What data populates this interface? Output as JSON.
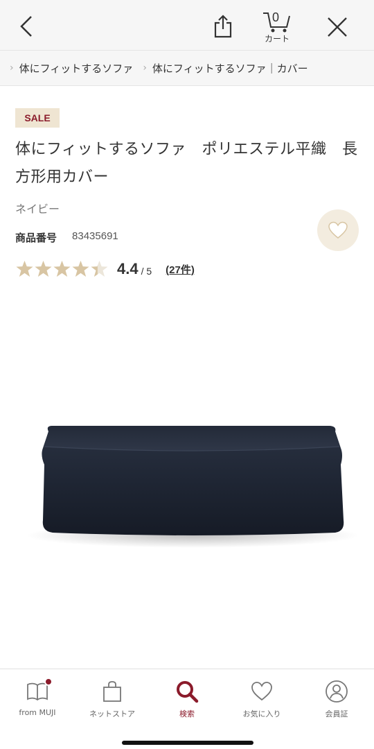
{
  "header": {
    "cart_count": "0",
    "cart_label": "カート"
  },
  "breadcrumb": {
    "items": [
      "体にフィットするソファ",
      "体にフィットするソファ｜カバー"
    ]
  },
  "product": {
    "badge": "SALE",
    "title": "体にフィットするソファ　ポリエステル平織　長方形用カバー",
    "color": "ネイビー",
    "number_label": "商品番号",
    "number_value": "83435691",
    "rating_value": "4.4",
    "rating_max": "/ 5",
    "rating_fraction": 0.88,
    "review_count": "(27件)"
  },
  "tabbar": {
    "items": [
      {
        "label": "from MUJI",
        "icon": "book-icon"
      },
      {
        "label": "ネットストア",
        "icon": "shopping-bag-icon"
      },
      {
        "label": "検索",
        "icon": "search-icon"
      },
      {
        "label": "お気に入り",
        "icon": "heart-icon"
      },
      {
        "label": "会員証",
        "icon": "member-card-icon"
      }
    ]
  },
  "colors": {
    "accent": "#8b1b2b",
    "star": "#d8c5a3",
    "sofa": "#1e2533"
  }
}
